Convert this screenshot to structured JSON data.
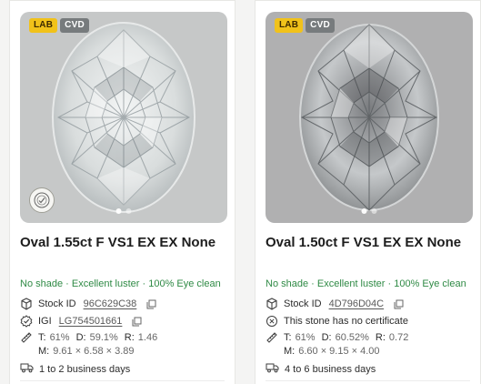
{
  "colors": {
    "quality_green": "#2f8a45",
    "lab_badge": "#f1c21a",
    "cvd_badge": "#777b7d"
  },
  "products": [
    {
      "badges": [
        "LAB",
        "CVD"
      ],
      "title": "Oval 1.55ct F VS1 EX EX None",
      "quality": "No shade · Excellent luster · 100% Eye clean",
      "stock_label": "Stock ID",
      "stock_id": "96C629C38",
      "certificate_label": "IGI",
      "certificate_id": "LG754501661",
      "specs": {
        "t_label": "T:",
        "t_value": "61%",
        "d_label": "D:",
        "d_value": "59.1%",
        "r_label": "R:",
        "r_value": "1.46",
        "m_label": "M:",
        "m_value": "9.61 × 6.58 × 3.89"
      },
      "delivery": "1 to 2 business days",
      "icons": {
        "stock": "box-icon",
        "certificate": "verified-badge-icon",
        "measurement": "ruler-icon",
        "delivery": "truck-icon",
        "copy": "copy-icon",
        "seal": "certificate-seal-icon"
      }
    },
    {
      "badges": [
        "LAB",
        "CVD"
      ],
      "title": "Oval 1.50ct F VS1 EX EX None",
      "quality": "No shade · Excellent luster · 100% Eye clean",
      "stock_label": "Stock ID",
      "stock_id": "4D796D04C",
      "certificate_text": "This stone has no certificate",
      "specs": {
        "t_label": "T:",
        "t_value": "61%",
        "d_label": "D:",
        "d_value": "60.52%",
        "r_label": "R:",
        "r_value": "0.72",
        "m_label": "M:",
        "m_value": "6.60 × 9.15 × 4.00"
      },
      "delivery": "4 to 6 business days",
      "icons": {
        "stock": "box-icon",
        "certificate": "close-circle-icon",
        "measurement": "ruler-icon",
        "delivery": "truck-icon",
        "copy": "copy-icon"
      }
    }
  ]
}
